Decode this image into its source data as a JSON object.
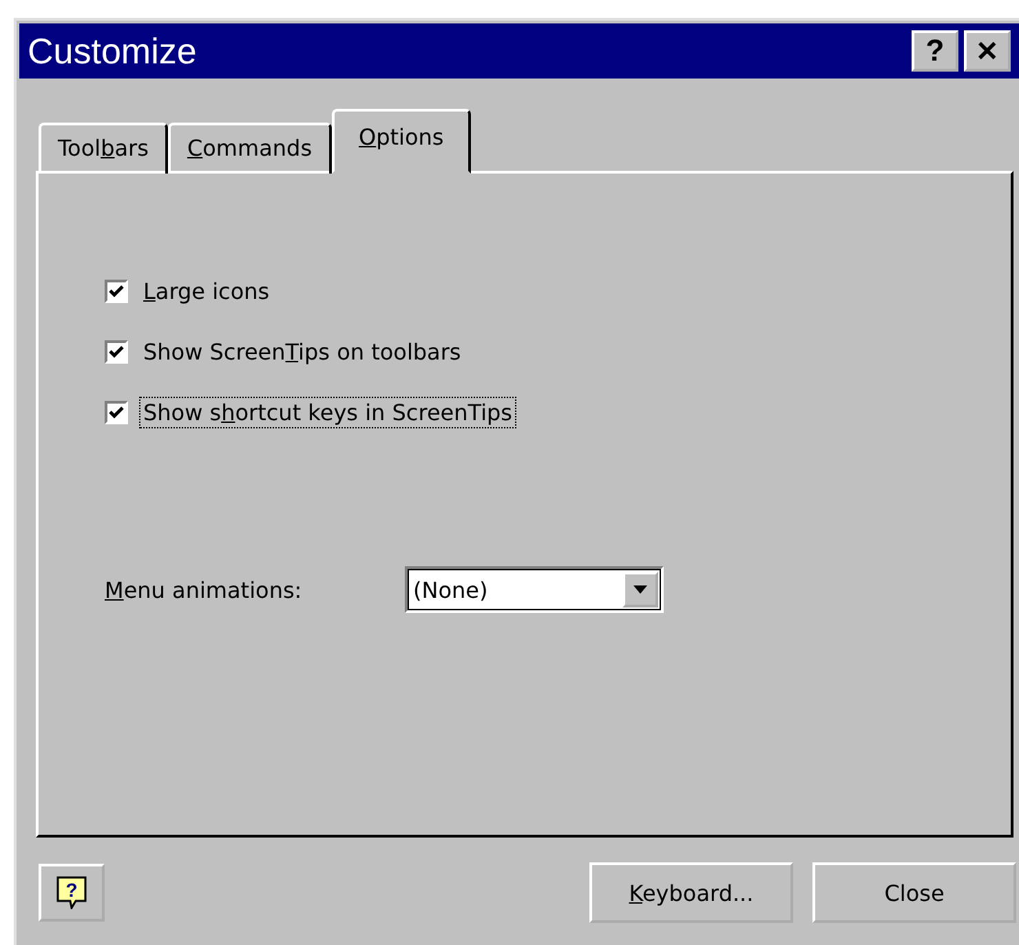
{
  "window": {
    "title": "Customize",
    "title_buttons": [
      {
        "kind": "help",
        "label": "?"
      },
      {
        "kind": "close",
        "label": "✕"
      }
    ]
  },
  "tabs": [
    {
      "before": "Tool",
      "key": "b",
      "after": "ars",
      "selected": false
    },
    {
      "key": "C",
      "after": "ommands",
      "selected": false
    },
    {
      "key": "O",
      "after": "ptions",
      "selected": true
    }
  ],
  "options": [
    {
      "key": "L",
      "after": "arge icons",
      "checked": true,
      "focused": false
    },
    {
      "before": "Show Screen",
      "key": "T",
      "after": "ips on toolbars",
      "checked": true,
      "focused": false
    },
    {
      "before": "Show s",
      "key": "h",
      "after": "ortcut keys in ScreenTips",
      "checked": true,
      "focused": true
    }
  ],
  "menu_animations": {
    "key": "M",
    "after": "enu animations:",
    "value": "(None)"
  },
  "help_button": {
    "label": "?"
  },
  "buttons": [
    {
      "key": "K",
      "after": "eyboard...",
      "kind": "text"
    },
    {
      "before": "Close",
      "kind": "text"
    }
  ]
}
